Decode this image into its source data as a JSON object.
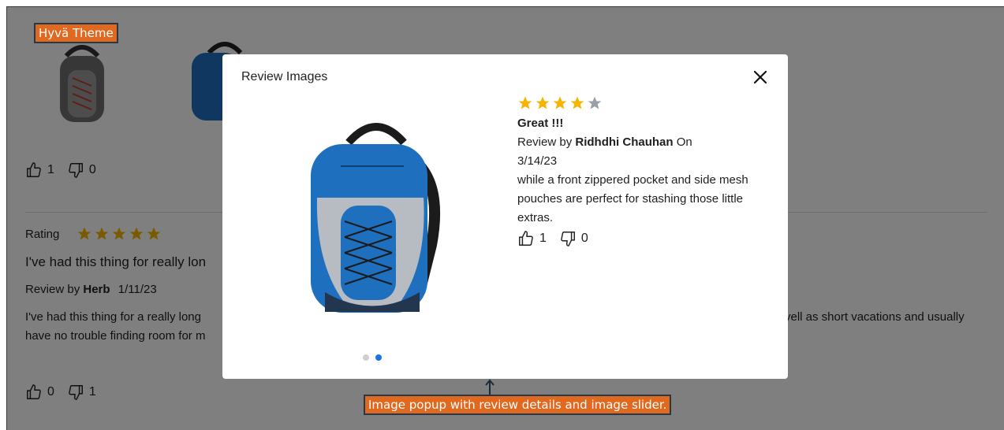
{
  "labels": {
    "theme_tag": "Hyvä Theme",
    "popup_tag": "Image popup with review details and image slider."
  },
  "background_review_1": {
    "helpful_count": "1",
    "not_helpful_count": "0"
  },
  "background_review_2": {
    "rating_label": "Rating",
    "rating": 5,
    "title": "I've had this thing for really lon",
    "review_by_prefix": "Review by",
    "author": "Herb",
    "date": "1/11/23",
    "body_left": "I've had this thing for a really long",
    "body_right": "vell as short vacations and usually",
    "body_line2": "have no trouble finding room for m",
    "helpful_count": "0",
    "not_helpful_count": "1"
  },
  "modal": {
    "title": "Review Images",
    "rating": 4,
    "rating_max": 5,
    "review_title": "Great !!!",
    "review_by_prefix": "Review by",
    "author": "Ridhdhi Chauhan",
    "on_label": "On",
    "date": "3/14/23",
    "body": "while a front zippered pocket and side mesh pouches are perfect for stashing those little extras.",
    "helpful_count": "1",
    "not_helpful_count": "0",
    "slides_total": 2,
    "active_slide": 2
  },
  "colors": {
    "star_filled": "#f5b400",
    "star_empty": "#9aa0a6",
    "accent": "#1a73e8",
    "tag_bg": "#e1681f",
    "backpack_blue": "#1f6fbf"
  },
  "icons": [
    "thumbs-up-icon",
    "thumbs-down-icon",
    "close-icon",
    "star-icon"
  ]
}
